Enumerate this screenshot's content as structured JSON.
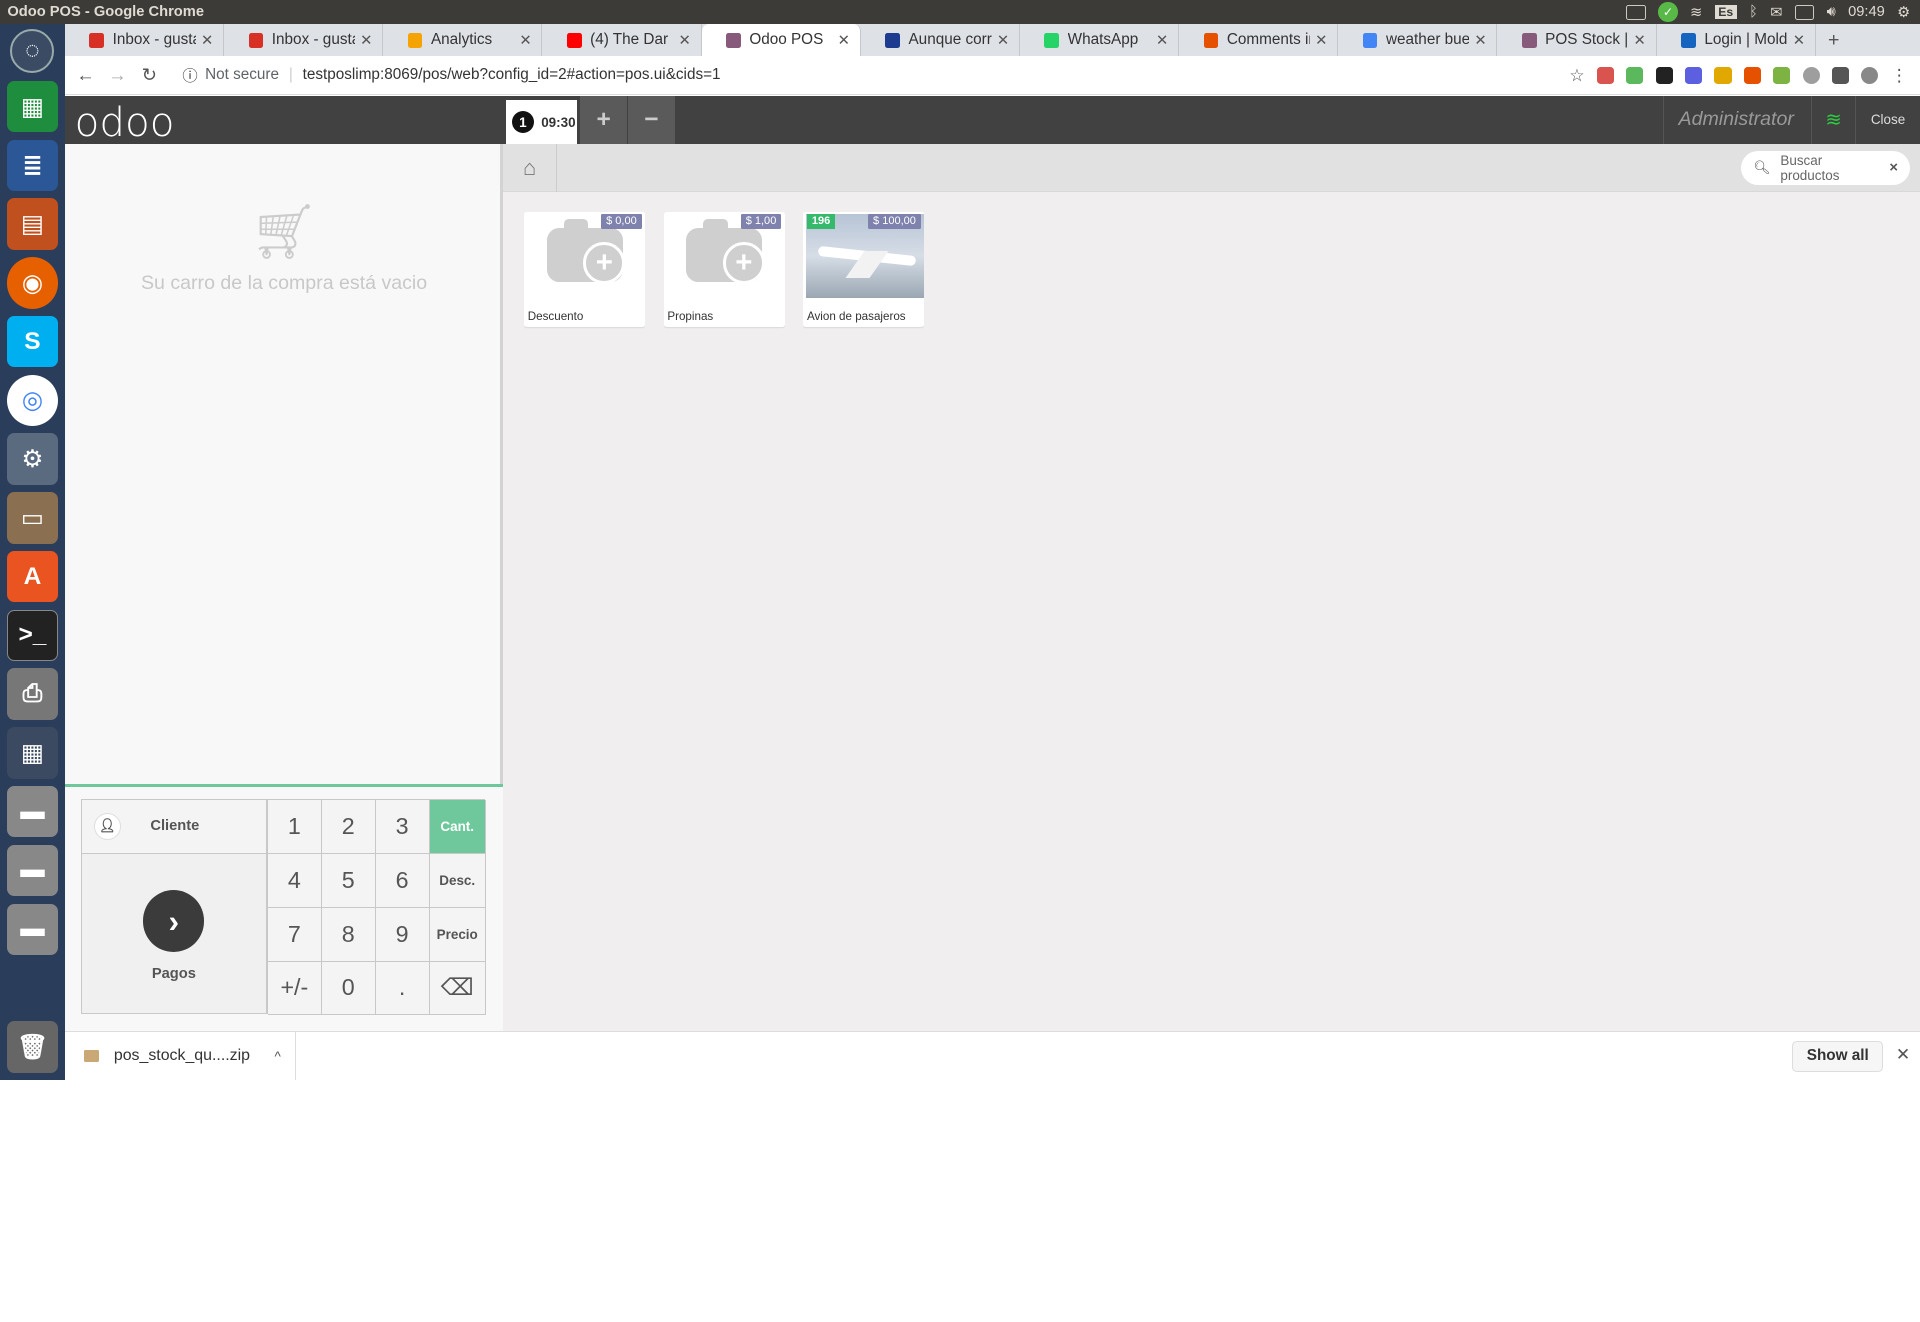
{
  "system": {
    "window_title": "Odoo POS - Google Chrome",
    "keyboard_layout": "Es",
    "clock": "09:49"
  },
  "tabs": [
    {
      "label": "Inbox - gustav",
      "color": "#d93025",
      "icon": "gmail-icon"
    },
    {
      "label": "Inbox - gustav",
      "color": "#d93025",
      "icon": "gmail-icon"
    },
    {
      "label": "Analytics",
      "color": "#f4a300",
      "icon": "analytics-icon"
    },
    {
      "label": "(4) The Dar",
      "color": "#ff0000",
      "icon": "youtube-icon"
    },
    {
      "label": "Odoo POS",
      "color": "#875a7b",
      "icon": "odoo-icon",
      "active": true
    },
    {
      "label": "Aunque corre",
      "color": "#1d3c8f",
      "icon": "news-icon"
    },
    {
      "label": "WhatsApp",
      "color": "#25d366",
      "icon": "whatsapp-icon"
    },
    {
      "label": "Comments in",
      "color": "#e65100",
      "icon": "comments-icon"
    },
    {
      "label": "weather buen",
      "color": "#4285f4",
      "icon": "google-icon"
    },
    {
      "label": "POS Stock | O",
      "color": "#875a7b",
      "icon": "odoo-icon"
    },
    {
      "label": "Login | Molde",
      "color": "#1565c0",
      "icon": "login-icon"
    }
  ],
  "browser": {
    "not_secure": "Not secure",
    "url": "testposlimp:8069/pos/web?config_id=2#action=pos.ui&cids=1"
  },
  "pos": {
    "logo": "odoo",
    "order_number": "1",
    "order_time": "09:30",
    "add_order": "+",
    "remove_order": "−",
    "user": "Administrator",
    "close_label": "Close",
    "empty_cart_msg": "Su carro de la compra está vacio",
    "customer_label": "Cliente",
    "payment_label": "Pagos",
    "search_placeholder": "Buscar productos",
    "numpad": {
      "keys": [
        "1",
        "2",
        "3",
        "4",
        "5",
        "6",
        "7",
        "8",
        "9",
        "+/-",
        "0",
        "."
      ],
      "modes": [
        "Cant.",
        "Desc.",
        "Precio"
      ],
      "active_mode": "Cant."
    },
    "products": [
      {
        "name": "Descuento",
        "price": "$ 0,00"
      },
      {
        "name": "Propinas",
        "price": "$ 1,00"
      },
      {
        "name": "Avion de pasajeros",
        "price": "$ 100,00",
        "stock": "196"
      }
    ],
    "accent_color": "#6ec89b",
    "price_tag_color": "#7f82ac",
    "stock_badge_color": "#35b96a"
  },
  "downloads": {
    "file": "pos_stock_qu....zip",
    "show_all": "Show all"
  }
}
